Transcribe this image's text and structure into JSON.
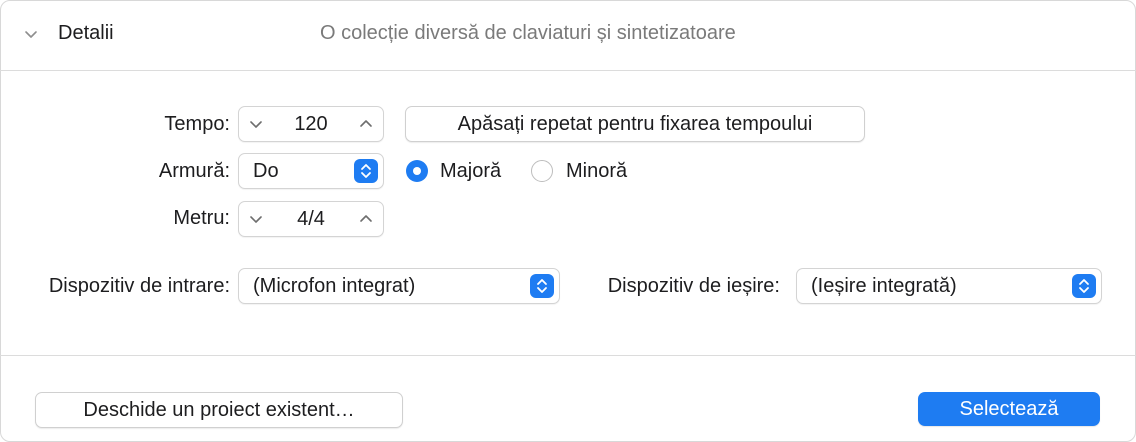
{
  "colors": {
    "accent": "#1e7cf2",
    "muted_text": "#7a7a7a"
  },
  "header": {
    "toggle_icon": "chevron-down-icon",
    "title": "Detalii",
    "subtitle": "O colecție diversă de claviaturi și sintetizatoare"
  },
  "tempo": {
    "label": "Tempo:",
    "value": "120",
    "tap_button": "Apăsați repetat pentru fixarea tempoului"
  },
  "key": {
    "label": "Armură:",
    "value": "Do",
    "major_label": "Majoră",
    "minor_label": "Minoră",
    "selected_mode": "major"
  },
  "meter": {
    "label": "Metru:",
    "value": "4/4"
  },
  "input_device": {
    "label": "Dispozitiv de intrare:",
    "value": "(Microfon integrat)"
  },
  "output_device": {
    "label": "Dispozitiv de ieșire:",
    "value": "(Ieșire integrată)"
  },
  "footer": {
    "open_existing": "Deschide un proiect existent…",
    "select": "Selectează"
  }
}
